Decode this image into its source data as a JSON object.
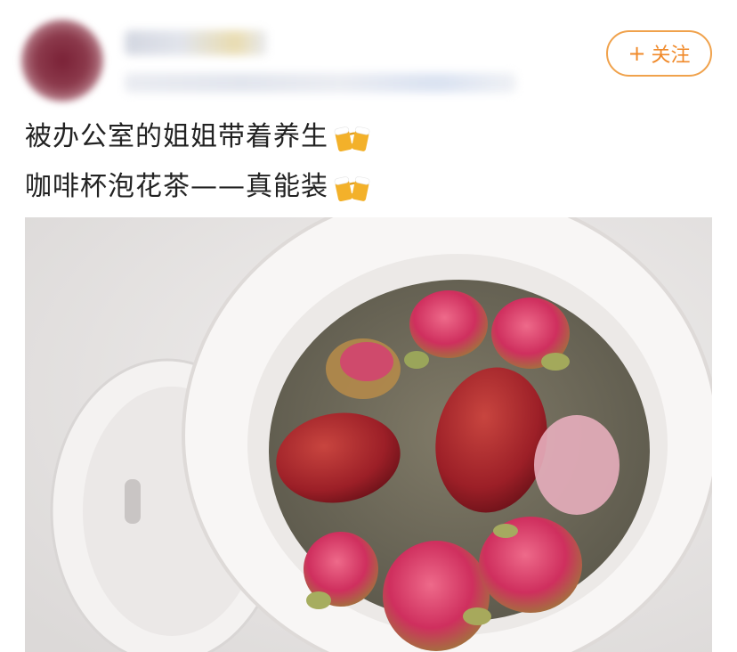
{
  "post": {
    "follow_label": "关注",
    "follow_plus": "+",
    "lines": [
      "被办公室的姐姐带着养生",
      "咖啡杯泡花茶——真能装"
    ],
    "emoji": "beer-mugs-icon"
  },
  "photo": {
    "subject": "rose-bud-and-jujube-tea-in-cup",
    "colors": {
      "cup": "#f7f5f4",
      "tea": "#6f6a5a",
      "jujube": "#a3232a",
      "rose": "#d33a68"
    }
  },
  "theme": {
    "accent": "#f08a2a",
    "text": "#222222"
  }
}
